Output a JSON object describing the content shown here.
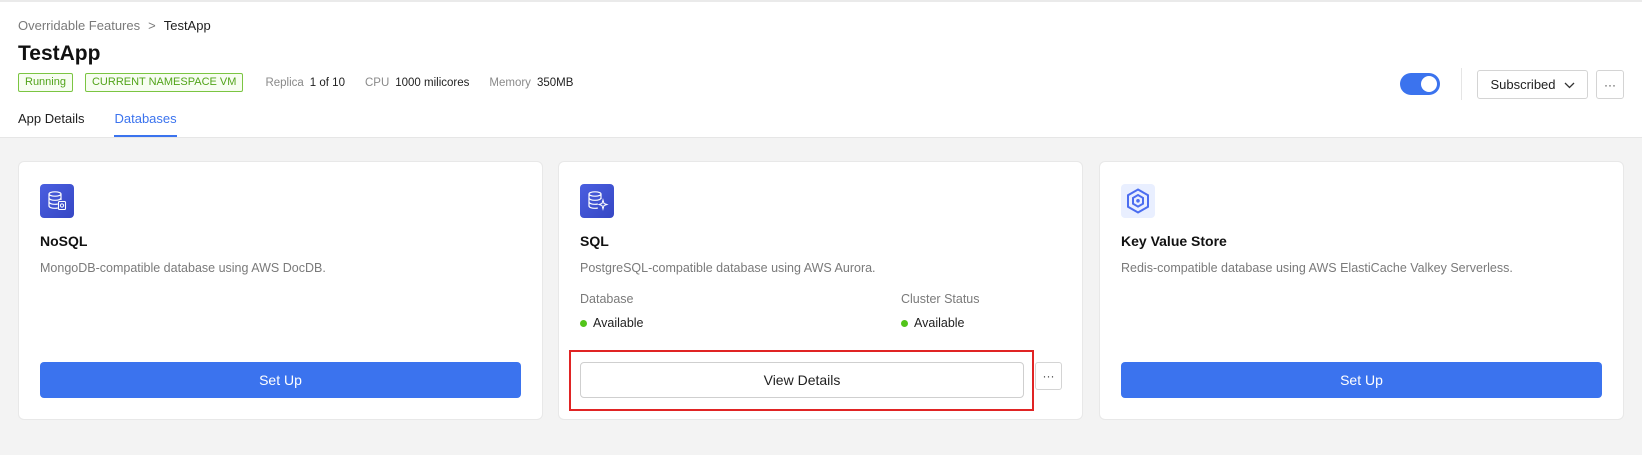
{
  "breadcrumb": {
    "parent": "Overridable Features",
    "separator": ">",
    "current": "TestApp"
  },
  "app": {
    "title": "TestApp",
    "status_tag": "Running",
    "namespace_tag": "CURRENT NAMESPACE VM",
    "replica_label": "Replica",
    "replica_value": "1 of 10",
    "cpu_label": "CPU",
    "cpu_value": "1000 milicores",
    "memory_label": "Memory",
    "memory_value": "350MB"
  },
  "controls": {
    "toggle_on": true,
    "subscribed_label": "Subscribed",
    "more_label": "···"
  },
  "tabs": [
    {
      "label": "App Details",
      "active": false
    },
    {
      "label": "Databases",
      "active": true
    }
  ],
  "cards": {
    "nosql": {
      "icon": "database-icon",
      "title": "NoSQL",
      "desc": "MongoDB-compatible database using AWS DocDB.",
      "button": "Set Up"
    },
    "sql": {
      "icon": "database-sparkle-icon",
      "title": "SQL",
      "desc": "PostgreSQL-compatible database using AWS Aurora.",
      "database_label": "Database",
      "database_status": "Available",
      "cluster_label": "Cluster Status",
      "cluster_status": "Available",
      "button": "View Details",
      "more_label": "···"
    },
    "kv": {
      "icon": "key-value-hex-icon",
      "title": "Key Value Store",
      "desc": "Redis-compatible database using AWS ElastiCache Valkey Serverless.",
      "button": "Set Up"
    }
  },
  "colors": {
    "accent": "#3b73ee",
    "success": "#52c41a",
    "highlight": "#e02424"
  }
}
